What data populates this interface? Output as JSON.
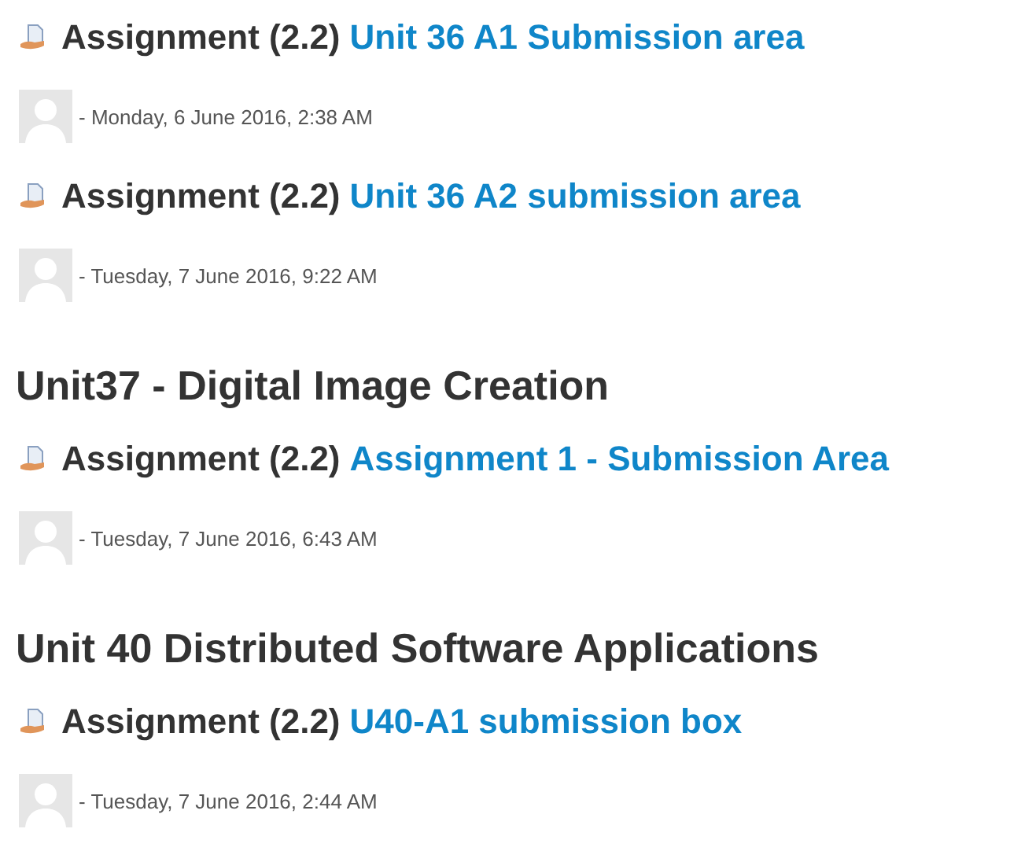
{
  "entries": [
    {
      "kind": "assignment",
      "type": "Assignment (2.2)",
      "link": "Unit 36 A1 Submission area",
      "date": "- Monday, 6 June 2016, 2:38 AM"
    },
    {
      "kind": "assignment",
      "type": "Assignment (2.2)",
      "link": "Unit 36 A2 submission area",
      "date": "- Tuesday, 7 June 2016, 9:22 AM"
    },
    {
      "kind": "heading",
      "text": "Unit37 - Digital Image Creation"
    },
    {
      "kind": "assignment",
      "type": "Assignment (2.2)",
      "link": "Assignment 1 - Submission Area",
      "date": "- Tuesday, 7 June 2016, 6:43 AM"
    },
    {
      "kind": "heading",
      "text": "Unit 40 Distributed Software Applications"
    },
    {
      "kind": "assignment",
      "type": "Assignment (2.2)",
      "link": "U40-A1 submission box",
      "date": "- Tuesday, 7 June 2016, 2:44 AM"
    }
  ]
}
